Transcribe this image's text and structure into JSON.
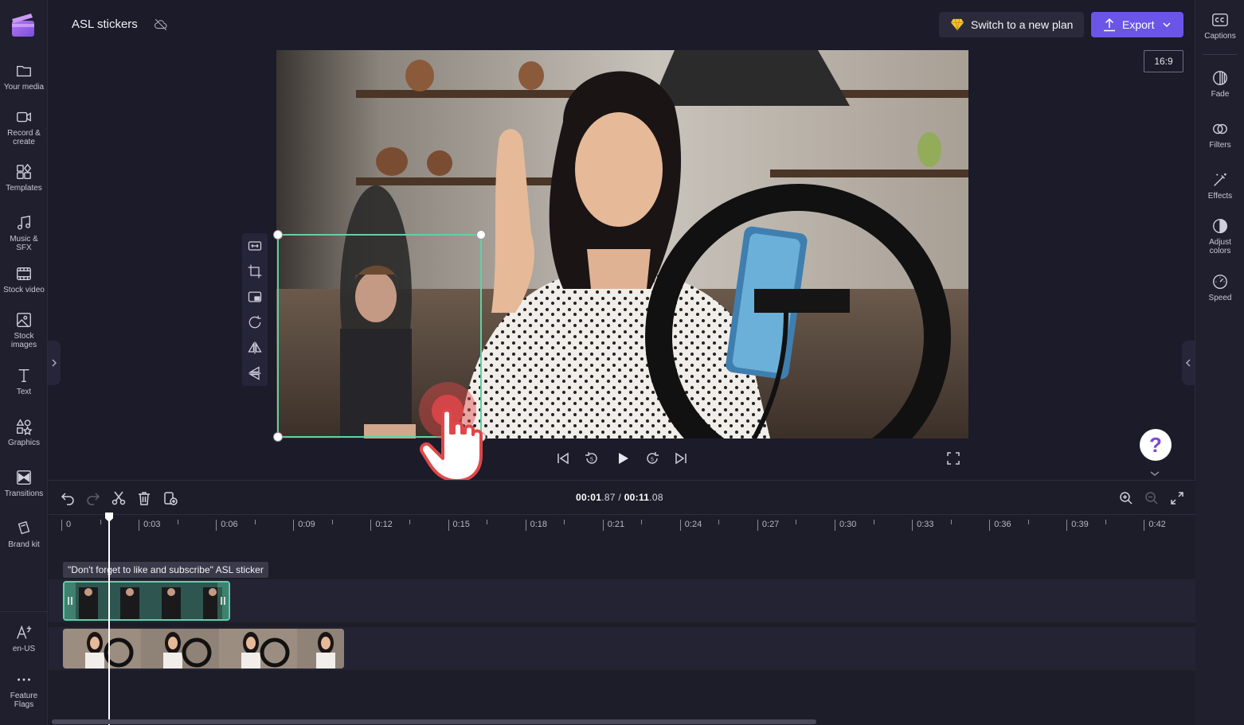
{
  "app": {
    "project_title": "ASL stickers"
  },
  "header": {
    "upgrade_label": "Switch to a new plan",
    "export_label": "Export",
    "aspect_ratio": "16:9"
  },
  "left_sidebar": {
    "items": [
      {
        "label": "Your media",
        "icon": "folder-icon"
      },
      {
        "label": "Record & create",
        "icon": "camera-icon"
      },
      {
        "label": "Templates",
        "icon": "templates-icon"
      },
      {
        "label": "Music & SFX",
        "icon": "music-icon"
      },
      {
        "label": "Stock video",
        "icon": "film-icon"
      },
      {
        "label": "Stock images",
        "icon": "image-icon"
      },
      {
        "label": "Text",
        "icon": "text-icon"
      },
      {
        "label": "Graphics",
        "icon": "shapes-icon"
      },
      {
        "label": "Transitions",
        "icon": "transitions-icon"
      },
      {
        "label": "Brand kit",
        "icon": "brand-kit-icon"
      }
    ],
    "bottom_items": [
      {
        "label": "en-US",
        "icon": "language-icon"
      },
      {
        "label": "Feature Flags",
        "icon": "more-icon"
      }
    ]
  },
  "right_sidebar": {
    "items": [
      {
        "label": "Captions",
        "icon": "captions-icon"
      },
      {
        "label": "Fade",
        "icon": "fade-icon"
      },
      {
        "label": "Filters",
        "icon": "filters-icon"
      },
      {
        "label": "Effects",
        "icon": "effects-icon"
      },
      {
        "label": "Adjust colors",
        "icon": "adjust-colors-icon"
      },
      {
        "label": "Speed",
        "icon": "speed-icon"
      }
    ]
  },
  "help": {
    "label": "?"
  },
  "timeline": {
    "current_time_main": "00:01",
    "current_time_frac": ".87",
    "separator": " / ",
    "total_time_main": "00:11",
    "total_time_frac": ".08",
    "ruler_labels": [
      "0",
      "0:03",
      "0:06",
      "0:09",
      "0:12",
      "0:15",
      "0:18",
      "0:21",
      "0:24",
      "0:27",
      "0:30",
      "0:33",
      "0:36",
      "0:39",
      "0:42"
    ],
    "sticker_clip_label": "\"Don't forget to like and subscribe\" ASL sticker",
    "playhead_seconds": 1.87,
    "total_seconds": 11.08
  },
  "colors": {
    "accent": "#6a55e8",
    "selection": "#5fd1a7",
    "background": "#1b1b29",
    "help_icon": "#7b47d8"
  }
}
